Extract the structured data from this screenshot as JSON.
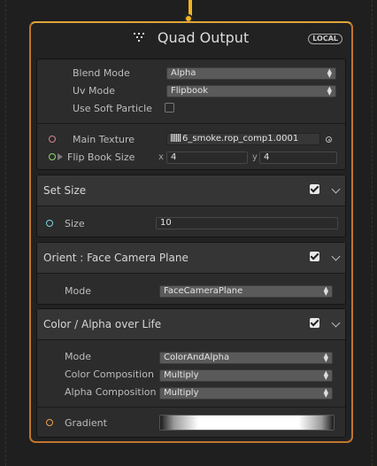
{
  "node": {
    "title": "Quad Output",
    "badge": "LOCAL",
    "settings": {
      "blend_mode": {
        "label": "Blend Mode",
        "value": "Alpha"
      },
      "uv_mode": {
        "label": "Uv Mode",
        "value": "Flipbook"
      },
      "use_soft_particle": {
        "label": "Use Soft Particle",
        "checked": false
      }
    },
    "inputs": {
      "main_texture": {
        "label": "Main Texture",
        "value": "6_smoke.rop_comp1.0001"
      },
      "flip_book_size": {
        "label": "Flip Book Size",
        "x_label": "x",
        "x": "4",
        "y_label": "y",
        "y": "4"
      }
    }
  },
  "blocks": [
    {
      "title": "Set Size",
      "enabled": true,
      "fields": [
        {
          "label": "Size",
          "value": "10"
        }
      ]
    },
    {
      "title": "Orient : Face Camera Plane",
      "enabled": true,
      "fields": [
        {
          "label": "Mode",
          "value": "FaceCameraPlane"
        }
      ]
    },
    {
      "title": "Color / Alpha over Life",
      "enabled": true,
      "fields": [
        {
          "label": "Mode",
          "value": "ColorAndAlpha"
        },
        {
          "label": "Color Composition",
          "value": "Multiply"
        },
        {
          "label": "Alpha Composition",
          "value": "Multiply"
        },
        {
          "label": "Gradient"
        }
      ]
    }
  ],
  "colors": {
    "wire": "#f2b51e",
    "node_border": "#c0752f",
    "slot_texture": "#d8848a",
    "slot_flipbook": "#8fd66a",
    "slot_size": "#7fd2e6",
    "slot_gradient": "#f0a34a"
  }
}
